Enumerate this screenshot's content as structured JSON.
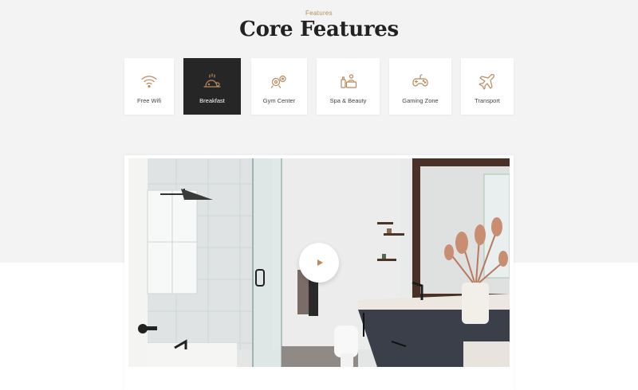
{
  "section": {
    "eyebrow": "Features",
    "title": "Core Features"
  },
  "features": [
    {
      "label": "Free Wifi",
      "icon": "wifi-icon",
      "active": false
    },
    {
      "label": "Breakfast",
      "icon": "breakfast-icon",
      "active": true
    },
    {
      "label": "Gym Center",
      "icon": "gym-icon",
      "active": false
    },
    {
      "label": "Spa & Beauty",
      "icon": "spa-icon",
      "active": false
    },
    {
      "label": "Gaming Zone",
      "icon": "gamepad-icon",
      "active": false
    },
    {
      "label": "Transport",
      "icon": "airplane-icon",
      "active": false
    }
  ],
  "video": {
    "play_icon": "play-icon"
  },
  "colors": {
    "accent": "#b98a5c",
    "active_card": "#262626",
    "band": "#f3f3f3",
    "title": "#222222"
  }
}
